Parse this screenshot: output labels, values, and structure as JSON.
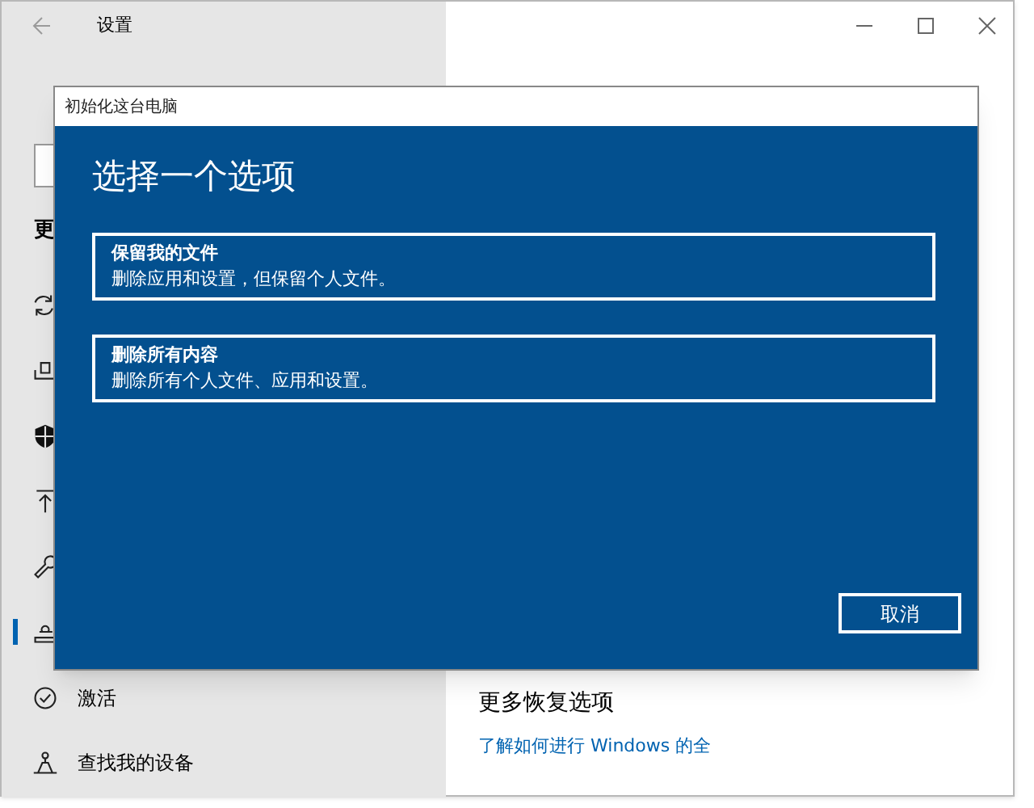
{
  "window": {
    "title": "设置"
  },
  "sidebar": {
    "section_heading": "更",
    "items": [
      {
        "kind": "sync",
        "selected": false
      },
      {
        "kind": "backup",
        "selected": false
      },
      {
        "kind": "shield",
        "selected": false
      },
      {
        "kind": "upload",
        "selected": false
      },
      {
        "kind": "wrench",
        "selected": false
      },
      {
        "kind": "recovery",
        "selected": true
      },
      {
        "kind": "check",
        "label": "激活",
        "selected": false
      },
      {
        "kind": "find",
        "label": "查找我的设备",
        "selected": false
      }
    ]
  },
  "content": {
    "section_heading": "更多恢复选项",
    "link": "了解如何进行 Windows 的全"
  },
  "dialog": {
    "title": "初始化这台电脑",
    "heading": "选择一个选项",
    "options": [
      {
        "title": "保留我的文件",
        "description": "删除应用和设置，但保留个人文件。"
      },
      {
        "title": "删除所有内容",
        "description": "删除所有个人文件、应用和设置。"
      }
    ],
    "cancel": "取消"
  }
}
